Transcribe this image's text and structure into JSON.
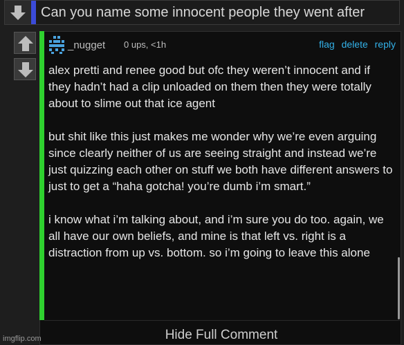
{
  "parent": {
    "text": "Can you name some innocent people they went after",
    "stripe_color": "#3b4bd8"
  },
  "vote_icons": [
    "upvote-arrow-icon",
    "downvote-arrow-icon"
  ],
  "comment": {
    "username": "_nugget",
    "meta": "0 ups, <1h",
    "actions": {
      "flag": "flag",
      "delete": "delete",
      "reply": "reply"
    },
    "paragraphs": [
      "alex pretti and renee good but ofc they weren’t innocent and if they hadn’t had a clip unloaded on them then they were totally about to slime out that ice agent",
      "but shit like this just makes me wonder why we’re even arguing since clearly neither of us are seeing straight and instead we’re just quizzing each other on stuff we both have different answers to just to get a “haha gotcha! you’re dumb i’m smart.”",
      "i know what i’m talking about, and i’m sure you do too. again, we all have our own beliefs, and mine is that left vs. right is a distraction from up vs. bottom. so i’m going to leave this alone"
    ],
    "toggle_label": "Hide Full Comment",
    "accent_color": "#2fd12f",
    "link_color": "#33b1e8"
  },
  "watermark": "imgflip.com"
}
